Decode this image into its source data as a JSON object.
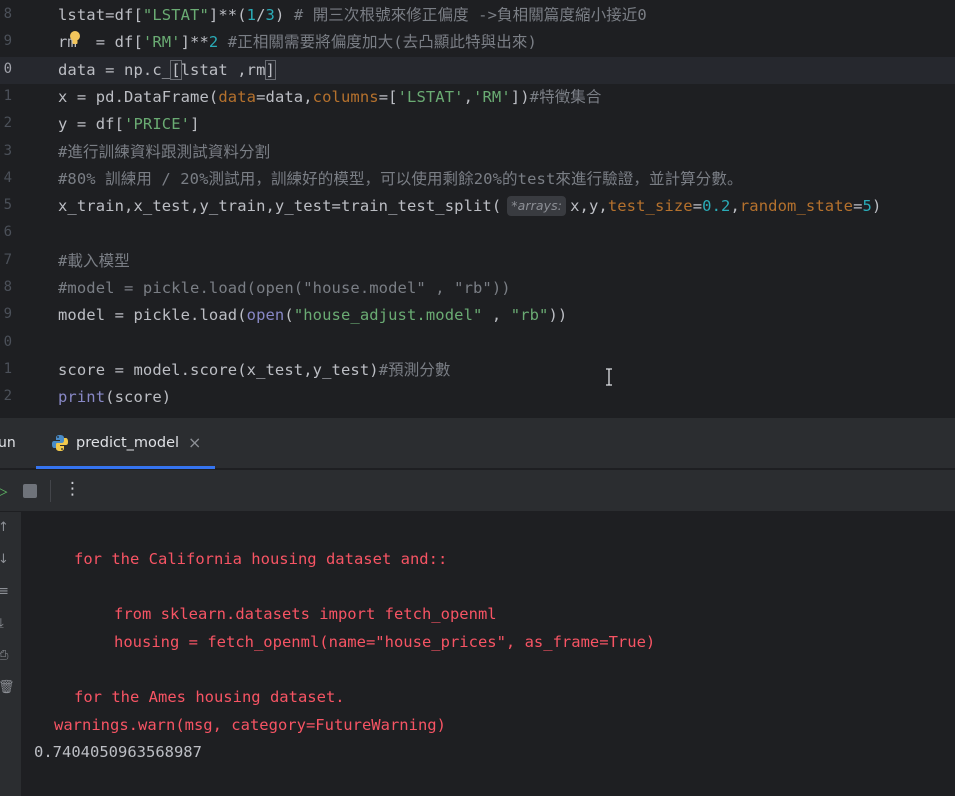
{
  "editor": {
    "lines": [
      {
        "num": "8",
        "tokens": [
          {
            "c": "t-plain",
            "t": "lstat=df["
          },
          {
            "c": "t-str",
            "t": "\"LSTAT\""
          },
          {
            "c": "t-plain",
            "t": "]**("
          },
          {
            "c": "t-num",
            "t": "1"
          },
          {
            "c": "t-plain",
            "t": "/"
          },
          {
            "c": "t-num",
            "t": "3"
          },
          {
            "c": "t-plain",
            "t": ") "
          },
          {
            "c": "t-cmt",
            "t": "# 開三次根號來修正偏度 ->負相關篇度縮小接近0"
          }
        ]
      },
      {
        "num": "9",
        "tokens": [
          {
            "c": "t-plain",
            "t": "rm  = df["
          },
          {
            "c": "t-str",
            "t": "'RM'"
          },
          {
            "c": "t-plain",
            "t": "]**"
          },
          {
            "c": "t-num",
            "t": "2"
          },
          {
            "c": "t-plain",
            "t": " "
          },
          {
            "c": "t-cmt",
            "t": "#正相關需要將偏度加大(去凸顯此特與出來)"
          }
        ]
      },
      {
        "num": "0",
        "current": true,
        "tokens": [
          {
            "c": "t-plain",
            "t": "data = np.c_"
          },
          {
            "c": "t-plain t-bracket",
            "t": "["
          },
          {
            "c": "t-plain",
            "t": "lstat ,rm"
          },
          {
            "c": "t-plain t-bracket",
            "t": "]"
          }
        ]
      },
      {
        "num": "1",
        "tokens": [
          {
            "c": "t-plain",
            "t": "x = pd.DataFrame("
          },
          {
            "c": "t-param",
            "t": "data"
          },
          {
            "c": "t-plain",
            "t": "=data,"
          },
          {
            "c": "t-param",
            "t": "columns"
          },
          {
            "c": "t-plain",
            "t": "=["
          },
          {
            "c": "t-str",
            "t": "'LSTAT'"
          },
          {
            "c": "t-plain",
            "t": ","
          },
          {
            "c": "t-str",
            "t": "'RM'"
          },
          {
            "c": "t-plain",
            "t": "])"
          },
          {
            "c": "t-cmt",
            "t": "#特徵集合"
          }
        ]
      },
      {
        "num": "2",
        "tokens": [
          {
            "c": "t-plain",
            "t": "y = df["
          },
          {
            "c": "t-str",
            "t": "'PRICE'"
          },
          {
            "c": "t-plain",
            "t": "]"
          }
        ]
      },
      {
        "num": "3",
        "tokens": [
          {
            "c": "t-cmt",
            "t": "#進行訓練資料跟測試資料分割"
          }
        ]
      },
      {
        "num": "4",
        "tokens": [
          {
            "c": "t-cmt",
            "t": "#80% 訓練用 / 20%測試用，訓練好的模型，可以使用剩餘20%的test來進行驗證，並計算分數。"
          }
        ]
      },
      {
        "num": "5",
        "tokens": [
          {
            "c": "t-plain",
            "t": "x_train,x_test,y_train,y_test=train_test_split("
          },
          {
            "c": "hint",
            "t": "*arrays:"
          },
          {
            "c": "t-plain",
            "t": "x,y,"
          },
          {
            "c": "t-param",
            "t": "test_size"
          },
          {
            "c": "t-plain",
            "t": "="
          },
          {
            "c": "t-num",
            "t": "0.2"
          },
          {
            "c": "t-plain",
            "t": ","
          },
          {
            "c": "t-param",
            "t": "random_state"
          },
          {
            "c": "t-plain",
            "t": "="
          },
          {
            "c": "t-num",
            "t": "5"
          },
          {
            "c": "t-plain",
            "t": ")"
          }
        ]
      },
      {
        "num": "6",
        "tokens": []
      },
      {
        "num": "7",
        "tokens": [
          {
            "c": "t-cmt",
            "t": "#載入模型"
          }
        ]
      },
      {
        "num": "8",
        "tokens": [
          {
            "c": "t-cmt",
            "t": "#model = pickle.load(open(\"house.model\" , \"rb\"))"
          }
        ]
      },
      {
        "num": "9",
        "tokens": [
          {
            "c": "t-plain",
            "t": "model = pickle.load("
          },
          {
            "c": "t-builtin",
            "t": "open"
          },
          {
            "c": "t-plain",
            "t": "("
          },
          {
            "c": "t-str",
            "t": "\"house_adjust.model\""
          },
          {
            "c": "t-plain",
            "t": " , "
          },
          {
            "c": "t-str",
            "t": "\"rb\""
          },
          {
            "c": "t-plain",
            "t": "))"
          }
        ]
      },
      {
        "num": "0",
        "tokens": []
      },
      {
        "num": "1",
        "tokens": [
          {
            "c": "t-plain",
            "t": "score = model.score(x_test,y_test)"
          },
          {
            "c": "t-cmt",
            "t": "#預測分數"
          }
        ]
      },
      {
        "num": "2",
        "tokens": [
          {
            "c": "t-builtin",
            "t": "print"
          },
          {
            "c": "t-plain",
            "t": "(score)"
          }
        ]
      }
    ]
  },
  "toolwindow": {
    "run_label": "un",
    "tab": {
      "label": "predict_model",
      "close": "×"
    },
    "toolbar": {
      "rerun": "▷",
      "more": "⋮"
    },
    "side_icons": [
      "↑",
      "↓",
      "≡",
      "⤓",
      "⎙",
      "🗑"
    ]
  },
  "console": {
    "lines": [
      {
        "cls": "c-err",
        "indent": 40,
        "text": "for the California housing dataset and::"
      },
      {
        "cls": "c-err",
        "indent": 0,
        "text": ""
      },
      {
        "cls": "c-err",
        "indent": 80,
        "text": "from sklearn.datasets import fetch_openml"
      },
      {
        "cls": "c-err",
        "indent": 80,
        "text": "housing = fetch_openml(name=\"house_prices\", as_frame=True)"
      },
      {
        "cls": "c-err",
        "indent": 0,
        "text": ""
      },
      {
        "cls": "c-err",
        "indent": 40,
        "text": "for the Ames housing dataset."
      },
      {
        "cls": "c-err",
        "indent": 20,
        "text": "warnings.warn(msg, category=FutureWarning)"
      },
      {
        "cls": "c-out",
        "indent": 0,
        "text": "0.7404050963568987"
      }
    ]
  }
}
